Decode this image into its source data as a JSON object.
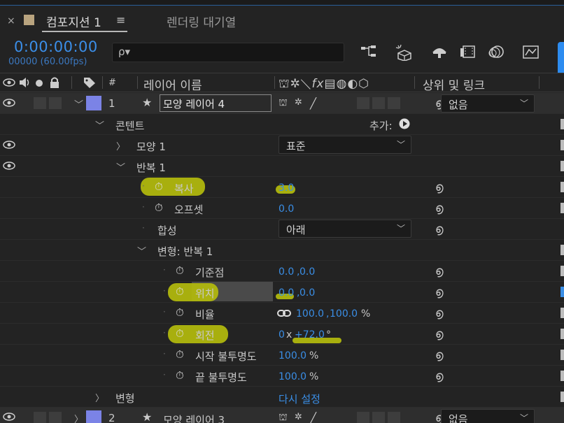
{
  "tab": {
    "close": "×",
    "title": "컴포지션 1",
    "menu": "≡",
    "render_queue": "렌더링 대기열"
  },
  "toolbar": {
    "timecode": "0:00:00:00",
    "frames_fps": "00000 (60.00fps)",
    "search_icon": "search-icon",
    "search_text": "ρ▾"
  },
  "header": {
    "num": "#",
    "layer_name": "레이어 이름",
    "parent_link": "상위 및 링크"
  },
  "rows": {
    "layer4": {
      "num": "1",
      "name": "모양 레이어 4",
      "parent": "없음"
    },
    "contents": {
      "label": "콘텐트",
      "add": "추가:"
    },
    "shape1": {
      "label": "모양 1",
      "blend": "표준"
    },
    "repeater": {
      "label": "반복 1"
    },
    "copies": {
      "label": "복사",
      "value": "3.0"
    },
    "offset": {
      "label": "오프셋",
      "value": "0.0"
    },
    "composite": {
      "label": "합성",
      "value": "아래"
    },
    "transform_rep": {
      "label": "변형: 반복 1"
    },
    "anchor": {
      "label": "기준점",
      "x": "0.0",
      "y": "0.0",
      "sep": ","
    },
    "position": {
      "label": "위치",
      "x": "0.0",
      "y": "0.0",
      "sep": ","
    },
    "scale": {
      "label": "비율",
      "x": "100.0",
      "y": "100.0",
      "sep": ",",
      "unit": "%"
    },
    "rotation": {
      "label": "회전",
      "turns": "0",
      "times": "x",
      "deg": "+72.0",
      "unit": "°"
    },
    "start_opacity": {
      "label": "시작 불투명도",
      "value": "100.0",
      "unit": "%"
    },
    "end_opacity": {
      "label": "끝 불투명도",
      "value": "100.0",
      "unit": "%"
    },
    "transform": {
      "label": "변형",
      "reset": "다시 설정"
    },
    "layer3": {
      "num": "2",
      "name": "모양 레이어 3",
      "parent": "없음"
    }
  },
  "colors": {
    "accent": "#3a8ee6",
    "highlight": "#b0b70e",
    "layer_label": "#7b83e6"
  }
}
